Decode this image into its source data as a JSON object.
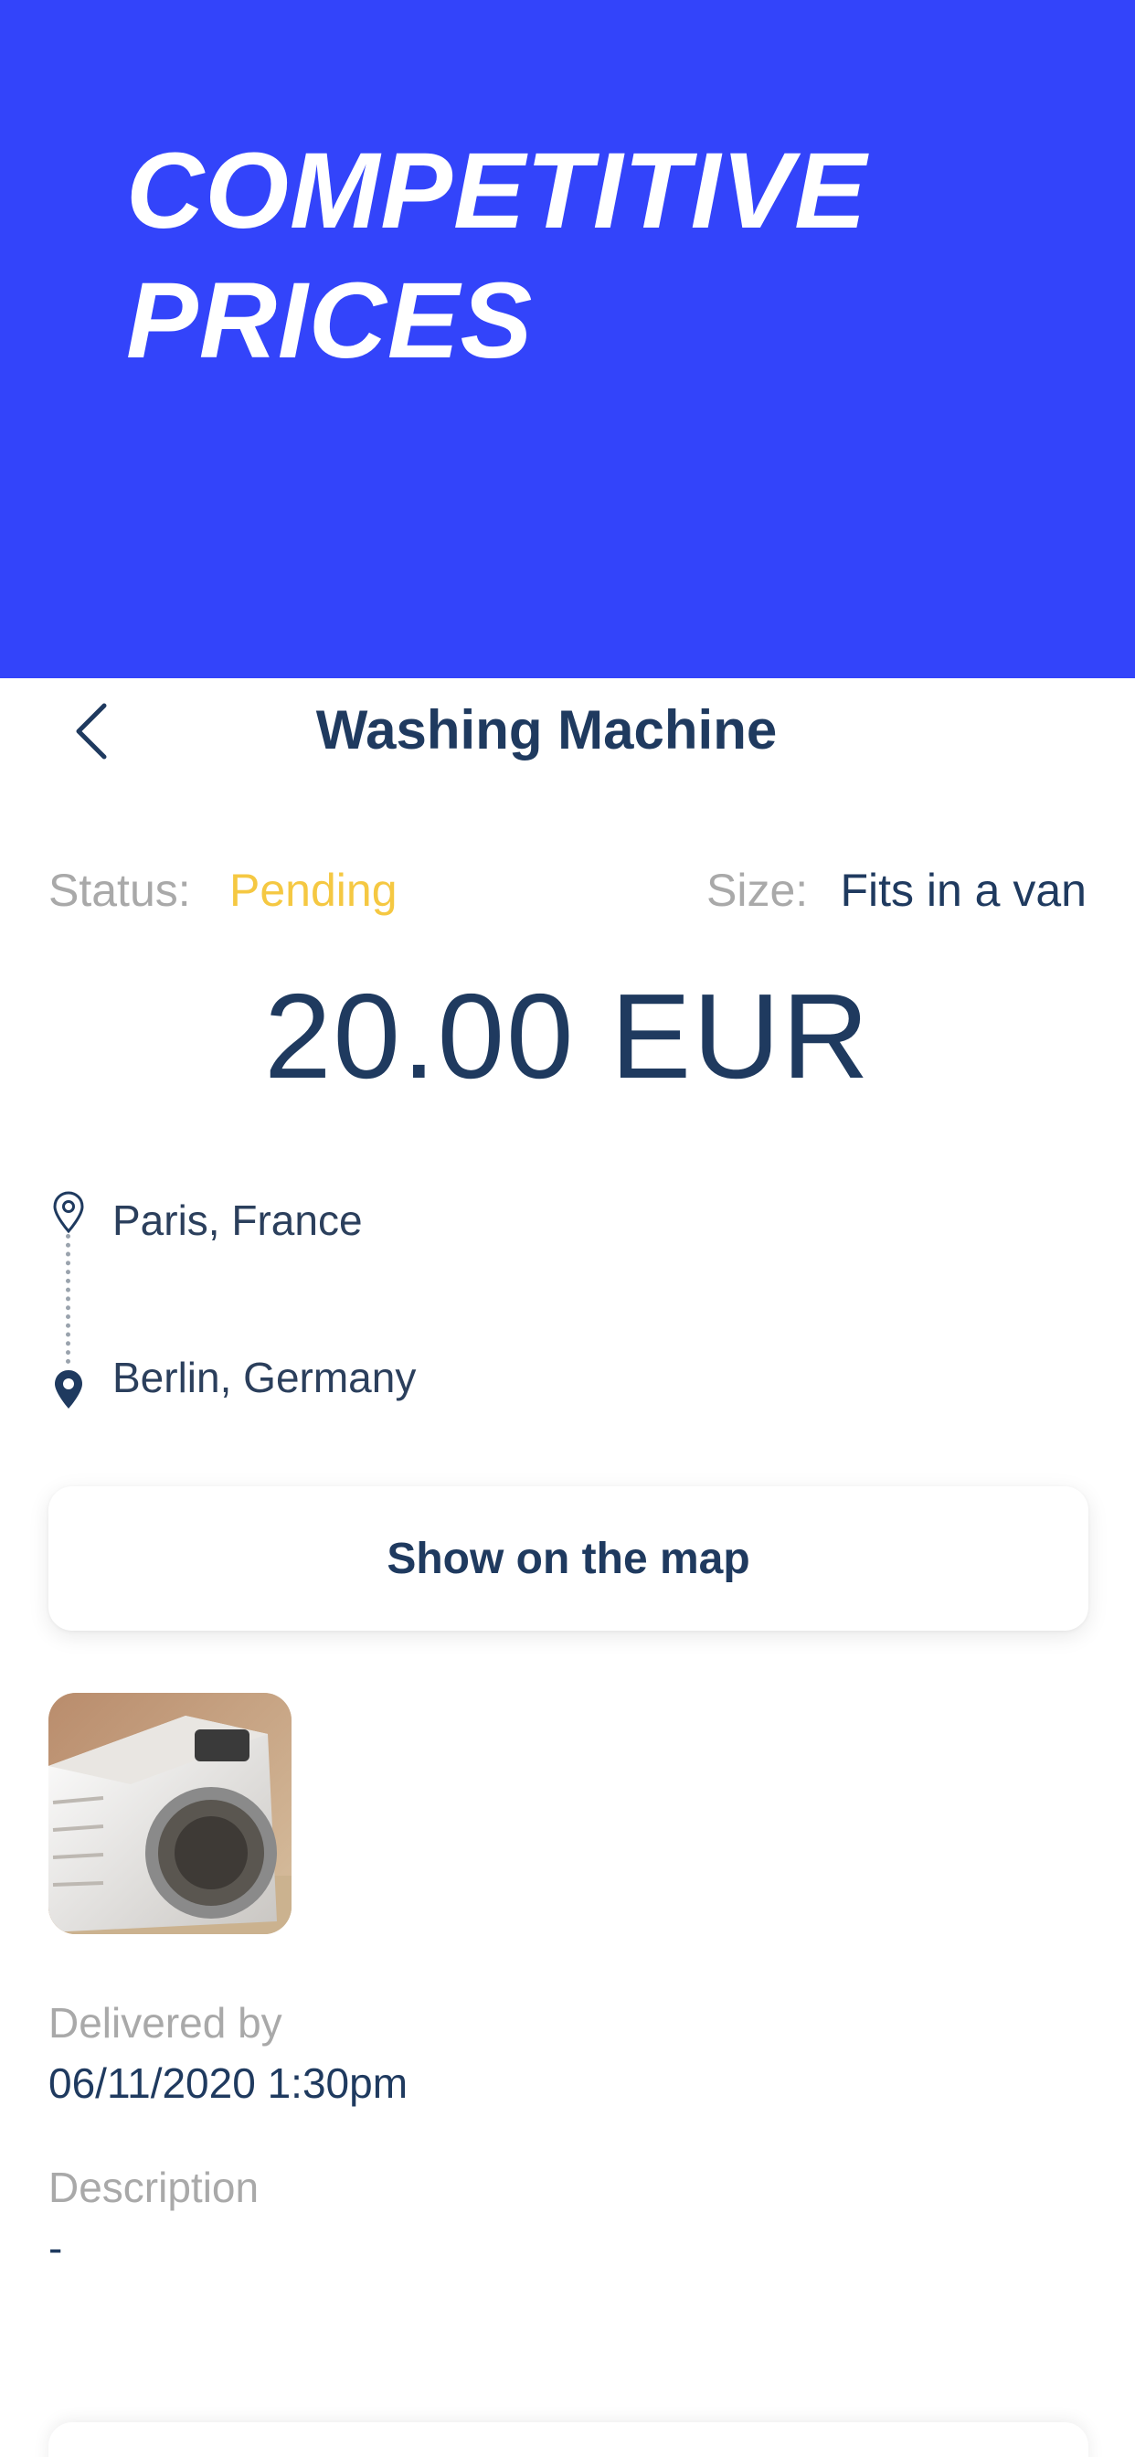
{
  "banner": {
    "title_line1": "COMPETITIVE",
    "title_line2": "PRICES",
    "background_color": "#3344fa"
  },
  "nav": {
    "back_icon": "chevron-left-icon",
    "title": "Washing Machine"
  },
  "details": {
    "status_label": "Status:",
    "status_value": "Pending",
    "status_color": "#f5c842",
    "size_label": "Size:",
    "size_value": "Fits in a van"
  },
  "price": "20.00 EUR",
  "route": {
    "from": "Paris, France",
    "to": "Berlin, Germany",
    "from_icon": "location-pin-outline-icon",
    "to_icon": "location-pin-filled-icon"
  },
  "map_button": {
    "label": "Show on the map"
  },
  "photo": {
    "icon": "washing-machine-photo"
  },
  "delivery": {
    "label": "Delivered by",
    "value": "06/11/2020 1:30pm"
  },
  "description": {
    "label": "Description",
    "value": "-"
  },
  "colors": {
    "primary_text": "#1f3a5f",
    "muted_text": "#a9a9a9",
    "accent": "#3344fa"
  }
}
